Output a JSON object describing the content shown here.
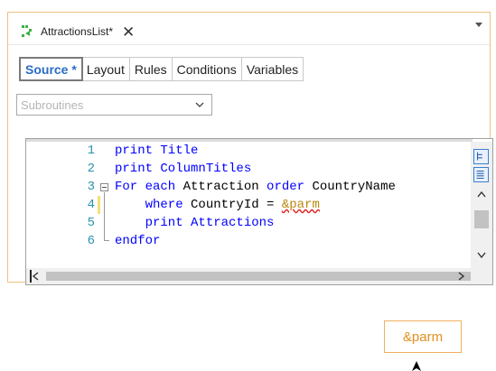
{
  "document_tab": {
    "title": "AttractionsList",
    "modified_marker": "*",
    "close_label": "✕"
  },
  "subtabs": [
    {
      "label": "Source *",
      "active": true
    },
    {
      "label": "Layout",
      "active": false
    },
    {
      "label": "Rules",
      "active": false
    },
    {
      "label": "Conditions",
      "active": false
    },
    {
      "label": "Variables",
      "active": false
    }
  ],
  "subroutines_combo": {
    "value": "Subroutines"
  },
  "editor": {
    "line_numbers": [
      "1",
      "2",
      "3",
      "4",
      "5",
      "6"
    ],
    "lines": [
      {
        "parts": [
          {
            "t": "print Title",
            "c": "kw-plain"
          }
        ]
      },
      {
        "parts": [
          {
            "t": "print ColumnTitles",
            "c": "kw-plain"
          }
        ]
      },
      {
        "parts": [
          {
            "t": "For each ",
            "c": "kw"
          },
          {
            "t": "Attraction ",
            "c": "plain"
          },
          {
            "t": "order ",
            "c": "kw"
          },
          {
            "t": "CountryName",
            "c": "plain"
          }
        ]
      },
      {
        "parts": [
          {
            "t": "    where ",
            "c": "kw"
          },
          {
            "t": "CountryId = ",
            "c": "plain"
          },
          {
            "t": "&parm",
            "c": "var"
          }
        ]
      },
      {
        "parts": [
          {
            "t": "    print Attractions",
            "c": "kw-plain"
          }
        ]
      },
      {
        "parts": [
          {
            "t": "endfor",
            "c": "kw"
          }
        ]
      }
    ]
  },
  "param_badge": {
    "label": "&parm"
  },
  "colors": {
    "keyword": "#0000ff",
    "variable": "#b8860b",
    "line_number": "#2b91af",
    "active_tab": "#2a6cc4",
    "badge": "#e2901f"
  },
  "icons": [
    "object-icon",
    "close-icon",
    "dropdown-arrow-icon",
    "chevron-down-icon",
    "fold-collapse-icon",
    "outline-icon",
    "list-icon",
    "scroll-up-icon",
    "scroll-down-icon",
    "scroll-left-icon",
    "scroll-right-icon",
    "mouse-cursor-icon"
  ]
}
